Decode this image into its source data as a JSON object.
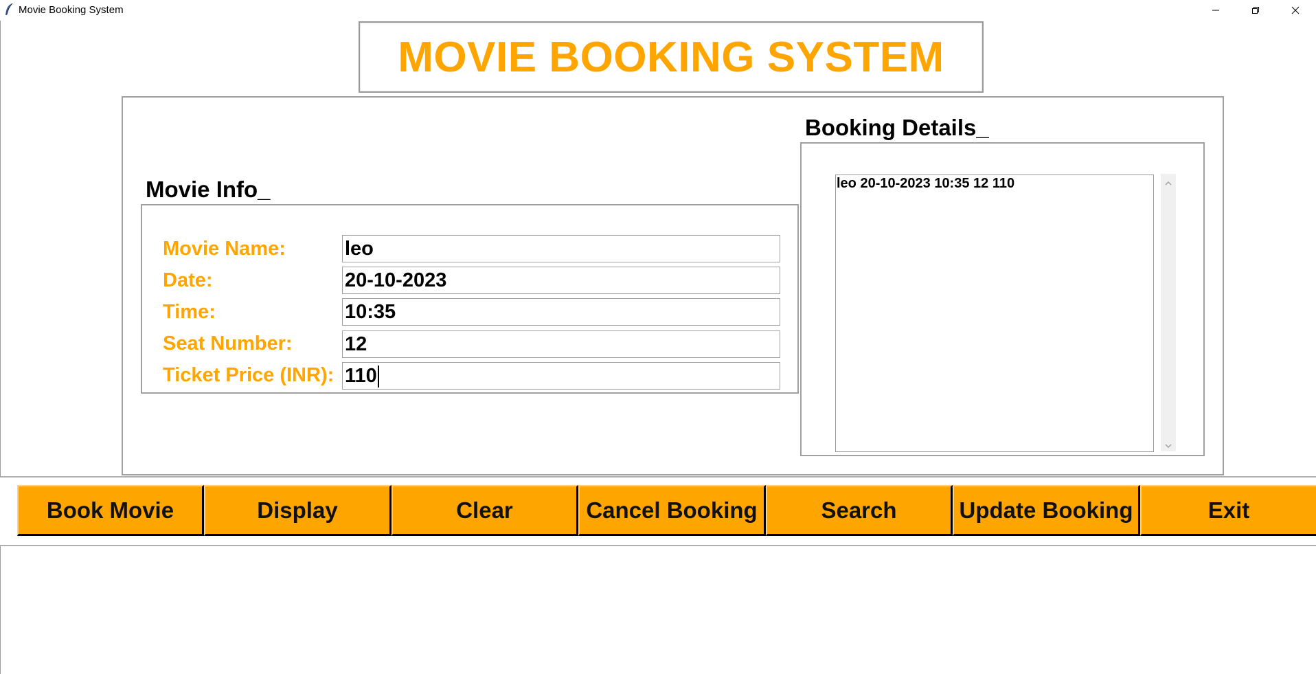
{
  "window": {
    "title": "Movie Booking System",
    "icon": "feather-icon",
    "controls": [
      "minimize-icon",
      "restore-icon",
      "close-icon"
    ]
  },
  "header": {
    "title": "MOVIE BOOKING SYSTEM"
  },
  "colors": {
    "accent": "#FFA500",
    "text": "#000000",
    "border": "#a0a0a0"
  },
  "movie_info": {
    "label": "Movie Info_",
    "fields": [
      {
        "label": "Movie Name:",
        "value": "leo"
      },
      {
        "label": "Date:",
        "value": "20-10-2023"
      },
      {
        "label": "Time:",
        "value": "10:35"
      },
      {
        "label": "Seat Number:",
        "value": "12"
      },
      {
        "label": "Ticket Price (INR):",
        "value": "110"
      }
    ]
  },
  "booking_details": {
    "label": "Booking Details_",
    "items": [
      "leo 20-10-2023 10:35 12 110"
    ]
  },
  "buttons": [
    "Book Movie",
    "Display",
    "Clear",
    "Cancel Booking",
    "Search",
    "Update Booking",
    "Exit"
  ]
}
